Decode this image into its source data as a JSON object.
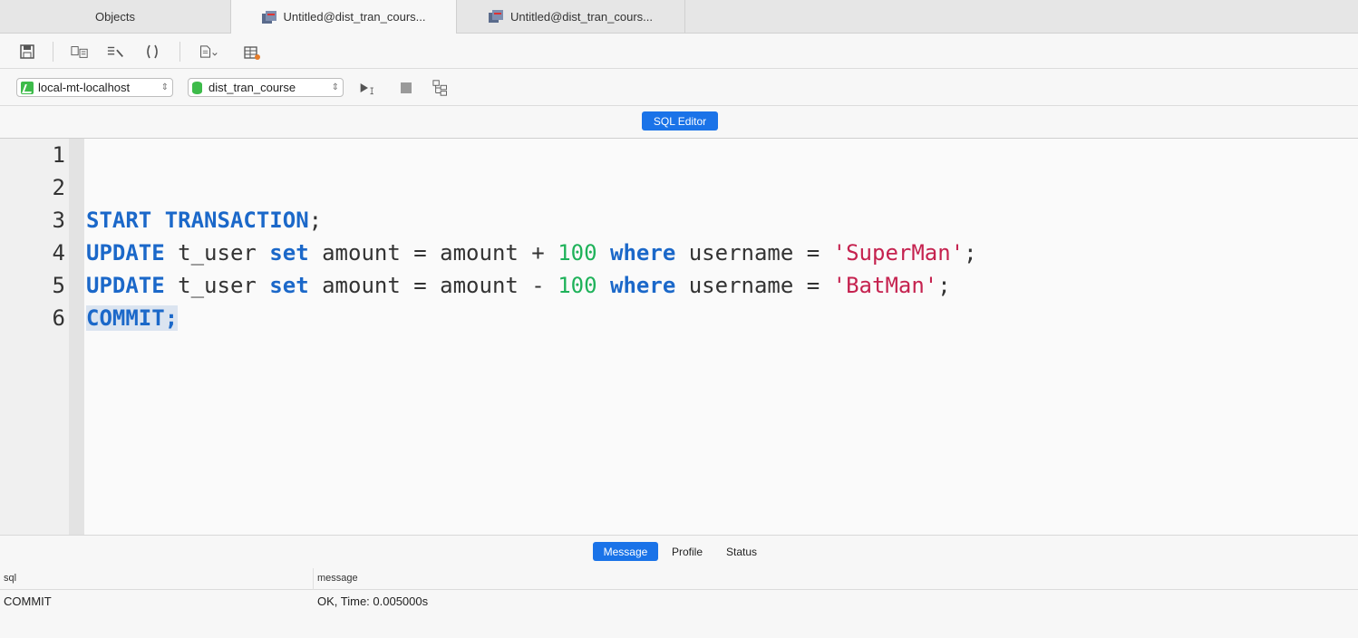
{
  "tabs": [
    {
      "label": "Objects"
    },
    {
      "label": "Untitled@dist_tran_cours..."
    },
    {
      "label": "Untitled@dist_tran_cours..."
    }
  ],
  "toolbar": {
    "icons": [
      "save-icon",
      "format-icon",
      "beautify-icon",
      "brackets-icon",
      "snippet-icon",
      "query-table-icon"
    ]
  },
  "connection": {
    "selected": "local-mt-localhost",
    "database": "dist_tran_course"
  },
  "mode": {
    "label": "SQL Editor"
  },
  "editor": {
    "line_numbers": [
      "1",
      "2",
      "3",
      "4",
      "5",
      "6"
    ],
    "lines": [
      [],
      [],
      [
        {
          "t": "START TRANSACTION",
          "c": "kw"
        },
        {
          "t": ";",
          "c": ""
        }
      ],
      [
        {
          "t": "UPDATE",
          "c": "kw"
        },
        {
          "t": " t_user ",
          "c": ""
        },
        {
          "t": "set",
          "c": "kw"
        },
        {
          "t": " amount = amount + ",
          "c": ""
        },
        {
          "t": "100",
          "c": "num"
        },
        {
          "t": " ",
          "c": ""
        },
        {
          "t": "where",
          "c": "kw"
        },
        {
          "t": " username = ",
          "c": ""
        },
        {
          "t": "'SuperMan'",
          "c": "str"
        },
        {
          "t": ";",
          "c": ""
        }
      ],
      [
        {
          "t": "UPDATE",
          "c": "kw"
        },
        {
          "t": " t_user ",
          "c": ""
        },
        {
          "t": "set",
          "c": "kw"
        },
        {
          "t": " amount = amount - ",
          "c": ""
        },
        {
          "t": "100",
          "c": "num"
        },
        {
          "t": " ",
          "c": ""
        },
        {
          "t": "where",
          "c": "kw"
        },
        {
          "t": " username = ",
          "c": ""
        },
        {
          "t": "'BatMan'",
          "c": "str"
        },
        {
          "t": ";",
          "c": ""
        }
      ],
      [
        {
          "t": "COMMIT;",
          "c": "fn sel"
        }
      ]
    ]
  },
  "results": {
    "tabs": [
      {
        "label": "Message"
      },
      {
        "label": "Profile"
      },
      {
        "label": "Status"
      }
    ],
    "columns": {
      "sql": "sql",
      "message": "message"
    },
    "rows": [
      {
        "sql": "COMMIT",
        "message": "OK, Time: 0.005000s"
      }
    ]
  },
  "colors": {
    "accent": "#1a73e8",
    "keyword": "#1b68c9",
    "number": "#1fb25a",
    "string": "#c5224f"
  }
}
